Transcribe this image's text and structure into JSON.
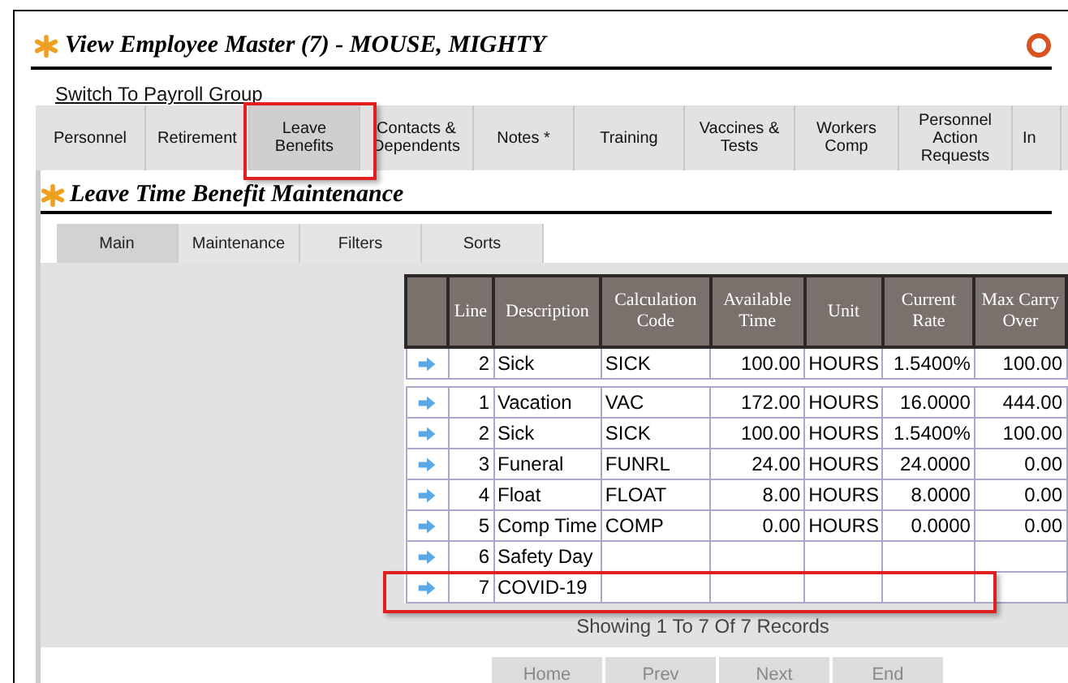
{
  "window": {
    "title": "View Employee Master (7) - MOUSE, MIGHTY"
  },
  "switch_link": "Switch To Payroll Group",
  "tabs": [
    {
      "label": "Personnel",
      "selected": false
    },
    {
      "label": "Retirement",
      "selected": false
    },
    {
      "label": "Leave Benefits",
      "selected": true
    },
    {
      "label": "Contacts & Dependents",
      "selected": false
    },
    {
      "label": "Notes *",
      "selected": false
    },
    {
      "label": "Training",
      "selected": false
    },
    {
      "label": "Vaccines & Tests",
      "selected": false
    },
    {
      "label": "Workers Comp",
      "selected": false
    },
    {
      "label": "Personnel Action Requests",
      "selected": false
    },
    {
      "label": "In",
      "selected": false
    }
  ],
  "section_title": "Leave Time Benefit Maintenance",
  "subtabs": [
    {
      "label": "Main",
      "selected": true
    },
    {
      "label": "Maintenance",
      "selected": false
    },
    {
      "label": "Filters",
      "selected": false
    },
    {
      "label": "Sorts",
      "selected": false
    }
  ],
  "table": {
    "columns": [
      "Line",
      "Description",
      "Calculation Code",
      "Available Time",
      "Unit",
      "Current Rate",
      "Max Carry Over"
    ],
    "current_rows": [
      [
        "2",
        "Sick",
        "SICK",
        "100.00",
        "HOURS",
        "1.5400%",
        "100.00"
      ]
    ],
    "rows": [
      [
        "1",
        "Vacation",
        "VAC",
        "172.00",
        "HOURS",
        "16.0000",
        "444.00"
      ],
      [
        "2",
        "Sick",
        "SICK",
        "100.00",
        "HOURS",
        "1.5400%",
        "100.00"
      ],
      [
        "3",
        "Funeral",
        "FUNRL",
        "24.00",
        "HOURS",
        "24.0000",
        "0.00"
      ],
      [
        "4",
        "Float",
        "FLOAT",
        "8.00",
        "HOURS",
        "8.0000",
        "0.00"
      ],
      [
        "5",
        "Comp Time",
        "COMP",
        "0.00",
        "HOURS",
        "0.0000",
        "0.00"
      ],
      [
        "6",
        "Safety Day",
        "",
        "",
        "",
        "",
        ""
      ],
      [
        "7",
        "COVID-19",
        "",
        "",
        "",
        "",
        ""
      ]
    ]
  },
  "records_text": "Showing 1 To 7 Of 7 Records",
  "nav_buttons": [
    {
      "label": "Home",
      "disabled": true
    },
    {
      "label": "Prev",
      "disabled": true
    },
    {
      "label": "Next",
      "disabled": true
    },
    {
      "label": "End",
      "disabled": true
    }
  ]
}
